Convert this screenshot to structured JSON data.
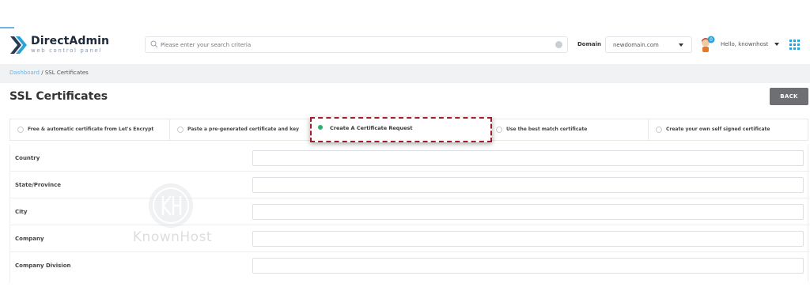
{
  "header": {
    "logo_title": "DirectAdmin",
    "logo_subtitle": "web control panel",
    "search_placeholder": "Please enter your search criteria",
    "domain_label": "Domain",
    "domain_value": "newdomain.com",
    "greeting": "Hello,",
    "username": "knownhost",
    "notification_count": "0",
    "accent_color": "#2aa4d8"
  },
  "breadcrumb": {
    "home": "Dashboard",
    "separator": "/",
    "current": "SSL Certificates"
  },
  "page": {
    "title": "SSL Certificates",
    "back_label": "BACK"
  },
  "cert_options": [
    {
      "label": "Free & automatic certificate from Let's Encrypt",
      "selected": false
    },
    {
      "label": "Paste a pre-generated certificate and key",
      "selected": false
    },
    {
      "label": "Create A Certificate Request",
      "selected": true
    },
    {
      "label": "Use the best match certificate",
      "selected": false
    },
    {
      "label": "Create your own self signed certificate",
      "selected": false
    }
  ],
  "form": {
    "fields": [
      {
        "label": "Country",
        "value": ""
      },
      {
        "label": "State/Province",
        "value": ""
      },
      {
        "label": "City",
        "value": ""
      },
      {
        "label": "Company",
        "value": ""
      },
      {
        "label": "Company Division",
        "value": ""
      }
    ]
  },
  "watermark": {
    "text": "KnownHost"
  },
  "colors": {
    "highlight_border": "#a11d2b",
    "selected_radio": "#27b36a",
    "back_button": "#6d6f72"
  }
}
